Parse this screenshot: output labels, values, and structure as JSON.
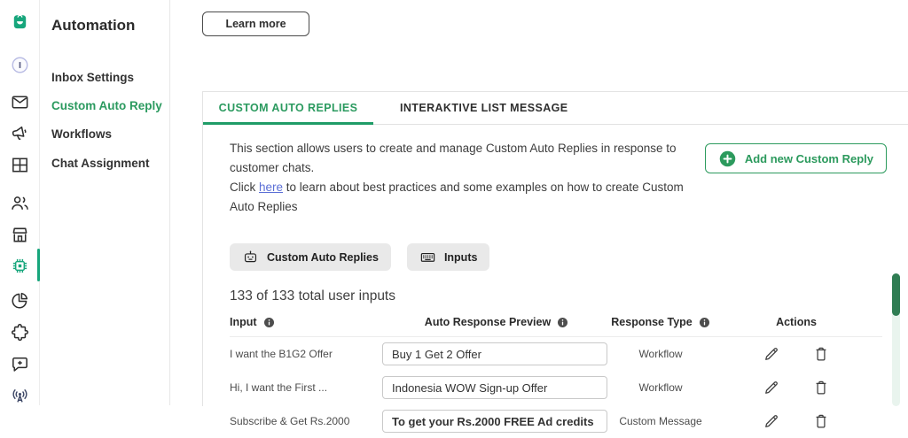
{
  "colors": {
    "accent_teal": "#17a67c",
    "primary_green": "#2b9a5f",
    "tab_underline": "#1f9c67",
    "link_blue": "#5b6fd6",
    "scroll_thumb": "#2f7d53",
    "chip_bg": "#e9e9e9"
  },
  "rail": {
    "icons": [
      "bag-icon",
      "profile-circle-icon",
      "envelope-icon",
      "megaphone-icon",
      "grid-icon",
      "people-icon",
      "store-icon",
      "chip-icon",
      "pie-chart-icon",
      "puzzle-icon",
      "chat-add-icon",
      "broadcast-icon"
    ]
  },
  "sidebar": {
    "title": "Automation",
    "items": [
      {
        "label": "Inbox Settings",
        "active": false
      },
      {
        "label": "Custom Auto Reply",
        "active": true
      },
      {
        "label": "Workflows",
        "active": false
      },
      {
        "label": "Chat Assignment",
        "active": false
      }
    ]
  },
  "header": {
    "learn_more_label": "Learn more"
  },
  "tabs": [
    {
      "label": "CUSTOM AUTO REPLIES",
      "active": true
    },
    {
      "label": "INTERAKTIVE LIST MESSAGE",
      "active": false
    }
  ],
  "intro": {
    "line1": "This section allows users to create and manage Custom Auto Replies in response to customer chats.",
    "line2_pre": "Click ",
    "link_text": "here",
    "line2_post": " to learn about best practices and some examples on how to create Custom Auto Replies",
    "add_button_label": "Add new Custom Reply"
  },
  "chips": [
    {
      "label": "Custom Auto Replies",
      "icon": "robot-icon"
    },
    {
      "label": "Inputs",
      "icon": "keyboard-icon"
    }
  ],
  "summary": "133 of 133 total user inputs",
  "table": {
    "columns": [
      {
        "label": "Input",
        "info": true
      },
      {
        "label": "Auto Response Preview",
        "info": true
      },
      {
        "label": "Response Type",
        "info": true
      },
      {
        "label": "Actions",
        "info": false
      }
    ],
    "rows": [
      {
        "input": "I want the B1G2 Offer",
        "preview": "Buy 1 Get 2 Offer",
        "response_type": "Workflow"
      },
      {
        "input": "Hi, I want the First ...",
        "preview": "Indonesia WOW Sign-up Offer",
        "response_type": "Workflow"
      },
      {
        "input": "Subscribe & Get Rs.2000",
        "preview": "To get your Rs.2000 FREE Ad credits",
        "response_type": "Custom Message"
      }
    ]
  }
}
